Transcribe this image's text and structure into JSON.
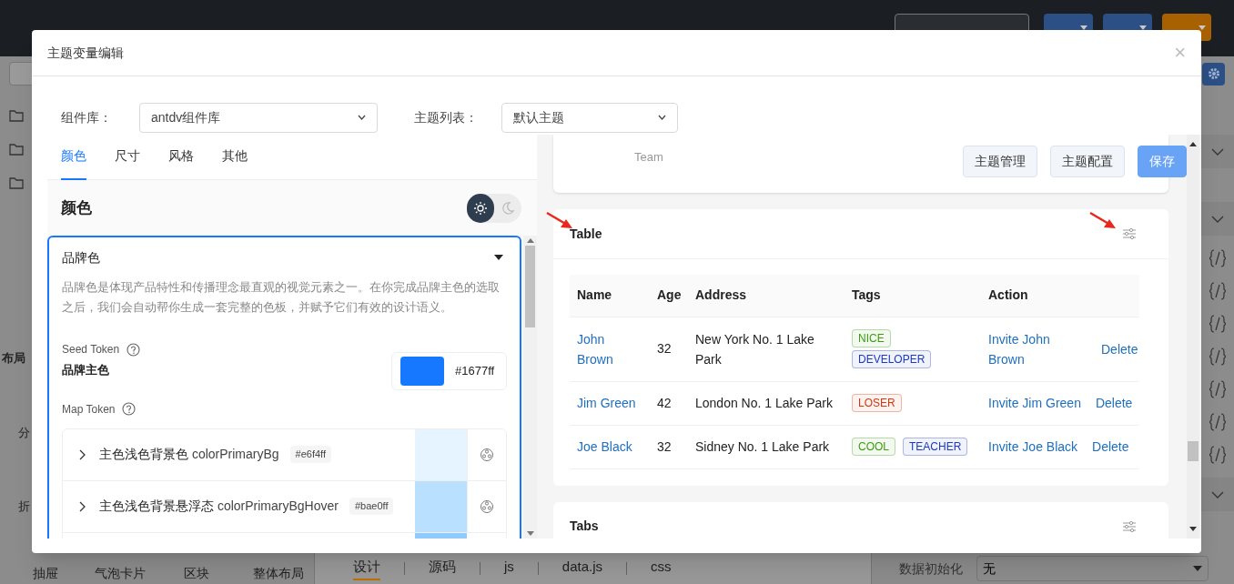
{
  "background": {
    "header_buttons": [
      {
        "kind": "primary"
      },
      {
        "kind": "primary"
      },
      {
        "kind": "warning"
      }
    ],
    "left_labels": [
      "布局",
      "分",
      "折"
    ],
    "palette": [
      "抽屉",
      "气泡卡片",
      "区块",
      "整体布局"
    ],
    "editor_tabs": [
      {
        "label": "设计",
        "selected": true
      },
      {
        "label": "源码",
        "selected": false
      },
      {
        "label": "js",
        "selected": false
      },
      {
        "label": "data.js",
        "selected": false
      },
      {
        "label": "css",
        "selected": false
      }
    ],
    "property": {
      "label": "数据初始化",
      "value": "无"
    }
  },
  "modal": {
    "title": "主题变量编辑",
    "close": "×",
    "component_library": {
      "label": "组件库：",
      "value": "antdv组件库"
    },
    "theme_list": {
      "label": "主题列表：",
      "value": "默认主题"
    },
    "tabs": [
      {
        "label": "颜色",
        "selected": true
      },
      {
        "label": "尺寸",
        "selected": false
      },
      {
        "label": "风格",
        "selected": false
      },
      {
        "label": "其他",
        "selected": false
      }
    ],
    "section_heading": "颜色",
    "modes": [
      {
        "kind": "light",
        "selected": true
      },
      {
        "kind": "dark",
        "selected": false
      }
    ],
    "brand": {
      "title": "品牌色",
      "expanded": true,
      "description": "品牌色是体现产品特性和传播理念最直观的视觉元素之一。在你完成品牌主色的选取之后，我们会自动帮你生成一套完整的色板，并赋予它们有效的设计语义。",
      "seed_label": "Seed Token",
      "seed_name": "品牌主色",
      "seed_value": "#1677ff",
      "map_label": "Map Token",
      "map_rows": [
        {
          "name": "主色浅色背景色",
          "token": "colorPrimaryBg",
          "hex": "#e6f4ff",
          "color": "#e6f4ff"
        },
        {
          "name": "主色浅色背景悬浮态",
          "token": "colorPrimaryBgHover",
          "hex": "#bae0ff",
          "color": "#bae0ff"
        }
      ],
      "next_swatch": {
        "color": "#91caff"
      }
    },
    "preview": {
      "intro_tail": "Team",
      "buttons": [
        {
          "label": "主题管理",
          "kind": "default"
        },
        {
          "label": "主题配置",
          "kind": "default"
        },
        {
          "label": "保存",
          "kind": "primary"
        }
      ],
      "table_card": {
        "title": "Table",
        "columns": [
          "Name",
          "Age",
          "Address",
          "Tags",
          "Action"
        ],
        "rows": [
          {
            "name": "John Brown",
            "age": "32",
            "address": "New York No. 1 Lake Park",
            "tags": [
              {
                "label": "NICE",
                "color": "#389e0d"
              },
              {
                "label": "DEVELOPER",
                "color": "#1d39c4"
              }
            ],
            "invite": "Invite John Brown",
            "delete": "Delete"
          },
          {
            "name": "Jim Green",
            "age": "42",
            "address": "London No. 1 Lake Park",
            "tags": [
              {
                "label": "LOSER",
                "color": "#d4380d"
              }
            ],
            "invite": "Invite Jim Green",
            "delete": "Delete"
          },
          {
            "name": "Joe Black",
            "age": "32",
            "address": "Sidney No. 1 Lake Park",
            "tags": [
              {
                "label": "COOL",
                "color": "#389e0d"
              },
              {
                "label": "TEACHER",
                "color": "#1d39c4"
              }
            ],
            "invite": "Invite Joe Black",
            "delete": "Delete"
          }
        ]
      },
      "tabs_card": {
        "title": "Tabs"
      }
    }
  }
}
